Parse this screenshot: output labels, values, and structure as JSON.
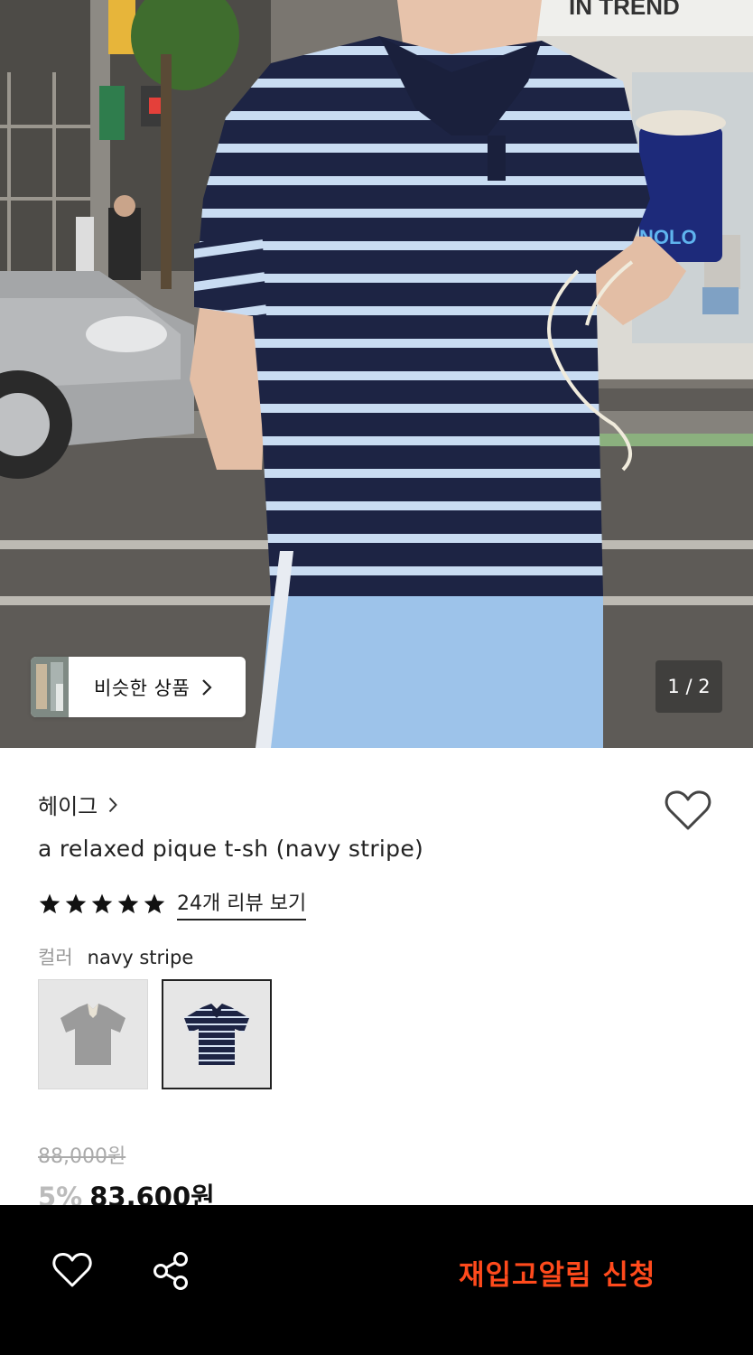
{
  "gallery": {
    "similar_label": "비슷한 상품",
    "pager": "1 / 2",
    "cup_text": "NOLO",
    "sign_text": "IN TREND"
  },
  "product": {
    "brand": "헤이그",
    "title": "a relaxed pique t-sh (navy stripe)",
    "rating_stars": 5,
    "review_link": "24개 리뷰 보기",
    "color_key": "컬러",
    "color_value": "navy stripe",
    "swatches": [
      {
        "name": "gray",
        "selected": false
      },
      {
        "name": "navy stripe",
        "selected": true
      }
    ],
    "price_original": "88,000원",
    "discount": "5%",
    "price_final": "83,600원"
  },
  "bottom_bar": {
    "wishlist_icon": "heart-icon",
    "share_icon": "share-icon",
    "restock_label": "재입고알림 신청"
  },
  "colors": {
    "accent": "#ff4a1c",
    "navy": "#1d2444",
    "stripe": "#c9dcf2",
    "pants": "#9dc3ea"
  }
}
